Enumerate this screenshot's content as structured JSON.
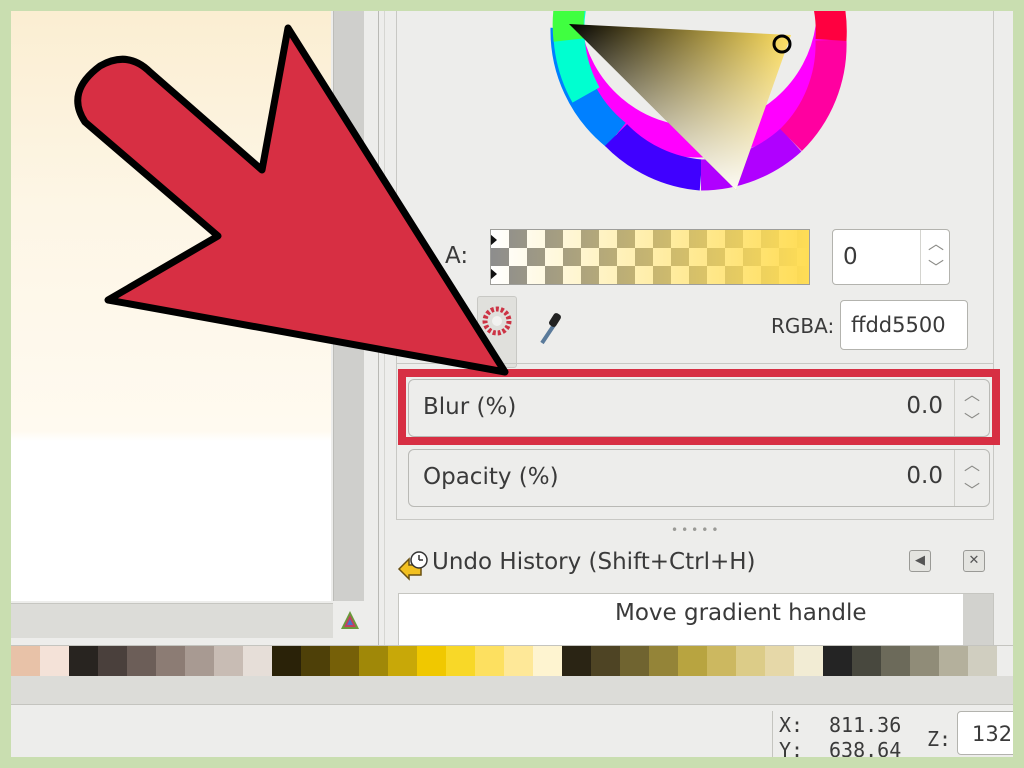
{
  "fill_stroke": {
    "alpha_label": "A:",
    "alpha_value": "0",
    "rgba_label": "RGBA:",
    "rgba_value": "ffdd5500",
    "selected_color": "#ffdd55"
  },
  "filters": {
    "blur_label": "Blur (%)",
    "blur_value": "0.0",
    "opacity_label": "Opacity (%)",
    "opacity_value": "0.0"
  },
  "undo_history": {
    "title": "Undo History (Shift+Ctrl+H)",
    "items": [
      "Move gradient handle"
    ]
  },
  "status": {
    "x_label": "X:",
    "x_value": "811.36",
    "y_label": "Y:",
    "y_value": "638.64",
    "z_label": "Z:",
    "zoom_value": "132"
  },
  "palette": {
    "swatches": [
      "#e8c2a8",
      "#f4e2d8",
      "#282420",
      "#4a403c",
      "#6c5e58",
      "#8c7c74",
      "#a89a92",
      "#c8bcb4",
      "#e6ded8",
      "#2a2208",
      "#4e4008",
      "#766008",
      "#a08808",
      "#c8a808",
      "#f0c800",
      "#f8d828",
      "#fde060",
      "#fee898",
      "#fef4d0",
      "#2a2414",
      "#4e4424",
      "#706430",
      "#948438",
      "#b8a440",
      "#ccb860",
      "#dccc88",
      "#e6d8a8",
      "#f2ecd4",
      "#242424",
      "#48483e",
      "#6c6a5a",
      "#908c78",
      "#b4b09c",
      "#d0cec0"
    ]
  },
  "annotation": {
    "arrow_color": "#d72f43",
    "highlight_color": "#d72f43"
  }
}
